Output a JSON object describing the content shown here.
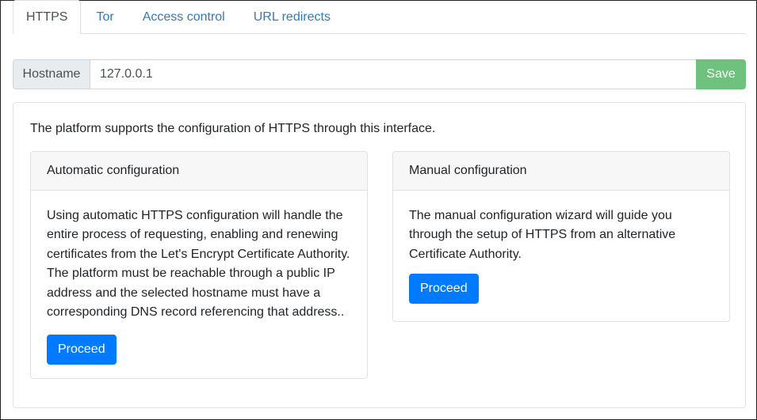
{
  "tabs": [
    {
      "label": "HTTPS",
      "active": true
    },
    {
      "label": "Tor",
      "active": false
    },
    {
      "label": "Access control",
      "active": false
    },
    {
      "label": "URL redirects",
      "active": false
    }
  ],
  "hostname": {
    "label": "Hostname",
    "value": "127.0.0.1",
    "save_label": "Save"
  },
  "intro": "The platform supports the configuration of HTTPS through this interface.",
  "automatic": {
    "title": "Automatic configuration",
    "lines": [
      "Using automatic HTTPS configuration will handle the",
      "entire process of requesting, enabling and renewing",
      "certificates from the Let's Encrypt Certificate Authority.",
      "The platform must be reachable through a public IP",
      "address and the selected hostname must have a",
      "corresponding DNS record referencing that address.."
    ],
    "button_label": "Proceed"
  },
  "manual": {
    "title": "Manual configuration",
    "lines": [
      "The manual configuration wizard will guide you",
      "through the setup of HTTPS from an alternative",
      "Certificate Authority."
    ],
    "button_label": "Proceed"
  },
  "colors": {
    "link": "#337ab7",
    "save": "#6fc17e",
    "primary": "#007bff"
  }
}
